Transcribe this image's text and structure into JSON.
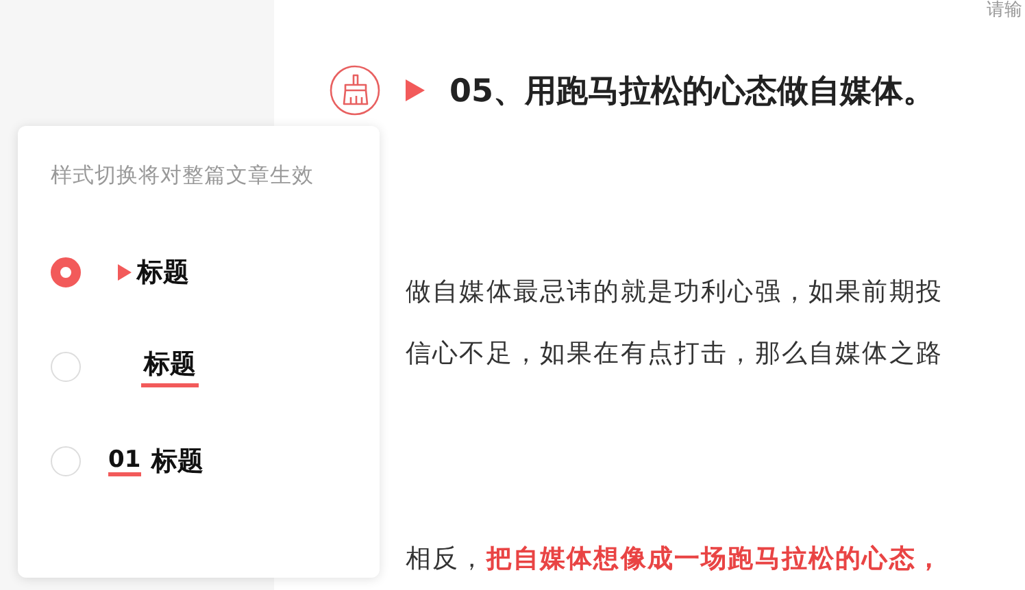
{
  "search_field": {
    "placeholder": "请输"
  },
  "heading": {
    "text": "05、用跑马拉松的心态做自媒体。"
  },
  "paragraphs": [
    {
      "text": "做自媒体最忌讳的就是功利心强，如果前期投"
    },
    {
      "text": "信心不足，如果在有点打击，那么自媒体之路"
    },
    {
      "text": "相反，**把自媒体想像成一场跑马拉松的心态，**"
    }
  ],
  "style_panel": {
    "hint": "样式切换将对整篇文章生效",
    "options": [
      {
        "kind": "triangle",
        "label": "标题",
        "selected": true
      },
      {
        "kind": "underline",
        "label": "标题",
        "selected": false
      },
      {
        "kind": "number",
        "number": "01",
        "label": "标题",
        "selected": false
      }
    ]
  }
}
